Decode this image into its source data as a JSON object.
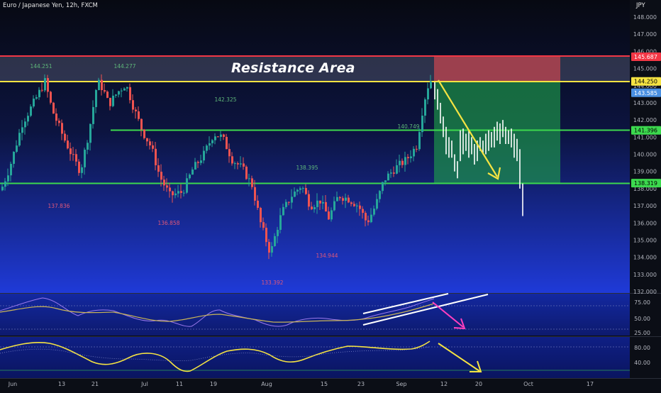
{
  "header": {
    "symbol": "Euro / Japanese Yen, 12h, FXCM",
    "currency": "JPY"
  },
  "annotation": {
    "resistance_area_label": "Resistance Area"
  },
  "price_axis": {
    "ticks": [
      "148.000",
      "147.000",
      "146.000",
      "145.000",
      "144.000",
      "143.000",
      "142.000",
      "141.000",
      "140.000",
      "139.000",
      "138.000",
      "137.000",
      "136.000",
      "135.000",
      "134.000",
      "133.000",
      "132.000"
    ],
    "tags": [
      {
        "value": "145.687",
        "color": "#f23645"
      },
      {
        "value": "144.250",
        "color": "#f5e342"
      },
      {
        "value": "143.585",
        "color": "#4a90e2"
      },
      {
        "value": "141.396",
        "color": "#3cd94e"
      },
      {
        "value": "138.319",
        "color": "#3cd94e"
      }
    ]
  },
  "pivot_labels": {
    "highs": [
      "144.251",
      "144.277",
      "142.325",
      "138.395",
      "140.749"
    ],
    "lows": [
      "137.836",
      "136.858",
      "133.392",
      "134.944"
    ]
  },
  "rsi_axis": [
    "75.00",
    "50.00",
    "25.00"
  ],
  "osc_axis": [
    "80.00",
    "40.00"
  ],
  "time_axis": [
    "Jun",
    "13",
    "21",
    "Jul",
    "11",
    "19",
    "Aug",
    "15",
    "23",
    "Sep",
    "12",
    "20",
    "Oct",
    "17"
  ],
  "colors": {
    "up": "#26a69a",
    "down": "#ef5350",
    "resistance": "#f23645",
    "yellow": "#f5e342",
    "support": "#3cd94e",
    "forecast": "#ffffff",
    "rsi": "#b388ff",
    "rsi_ma": "#c9b458",
    "arrow_rsi": "#ff3fbf"
  }
}
